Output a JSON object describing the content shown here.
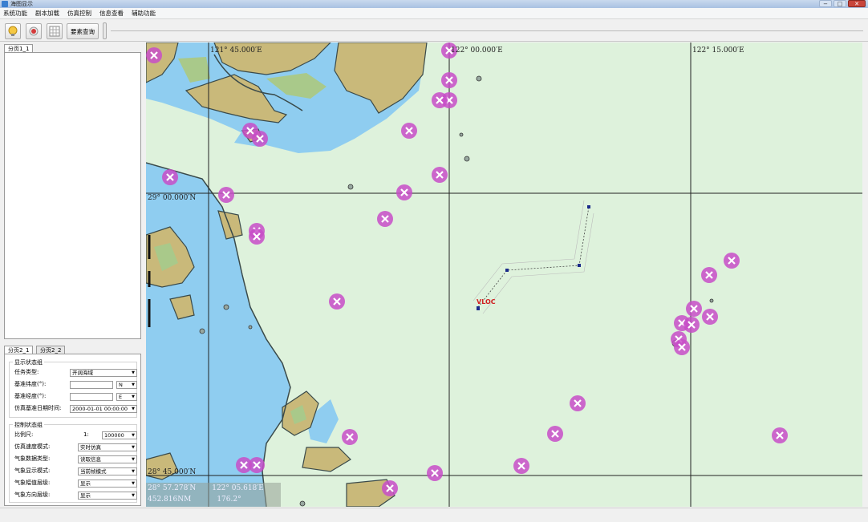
{
  "window": {
    "title": "海图显示",
    "min": "−",
    "max": "□",
    "close": "✕"
  },
  "menu": [
    "系统功能",
    "剧本加载",
    "仿真控制",
    "信息查看",
    "辅助功能"
  ],
  "toolbar": {
    "query_label": "要素查询",
    "icons": [
      "bulb-icon",
      "record-icon",
      "grid-icon"
    ]
  },
  "left_tabs_top": [
    {
      "label": "分页1_1"
    }
  ],
  "left_tabs_bottom": [
    {
      "label": "分页2_1"
    },
    {
      "label": "分页2_2"
    }
  ],
  "display_group": {
    "title": "显示状态组",
    "task_type_label": "任务类型:",
    "task_type_value": "开阔海域",
    "base_lat_label": "基准纬度(°):",
    "base_lat_value": "",
    "lat_hemi": "N",
    "base_lon_label": "基准经度(°):",
    "base_lon_value": "",
    "lon_hemi": "E",
    "sim_time_label": "仿真基准日期时间:",
    "sim_time_value": "2000-01-01 00:00:00"
  },
  "control_group": {
    "title": "控制状态组",
    "scale_label": "比例尺:",
    "scale_prefix": "1:",
    "scale_value": "100000",
    "speed_mode_label": "仿真速度模式:",
    "speed_mode_value": "实时仿真",
    "weather_data_label": "气象数据类型:",
    "weather_data_value": "读取信息",
    "weather_display_label": "气象显示模式:",
    "weather_display_value": "当前帧模式",
    "weather_amp_label": "气象幅值层级:",
    "weather_amp_value": "显示",
    "weather_dir_label": "气象方向层级:",
    "weather_dir_value": "显示"
  },
  "map": {
    "lon_labels": [
      "121° 45.000′E",
      "122° 00.000′E",
      "122° 15.000′E"
    ],
    "lat_labels": [
      "29° 00.000′N",
      "28° 45.000′N"
    ],
    "target_label": "VLOC",
    "readout": {
      "lat": "28° 57.278′N",
      "lon": "122° 05.618′E",
      "dist": "452.816NM",
      "bearing": "176.2°"
    }
  },
  "colors": {
    "land": "#c9b97a",
    "land_green": "#a9c98a",
    "shallow": "#8fcdf0",
    "deep": "#def2dc",
    "marker": "#c84ec8"
  }
}
